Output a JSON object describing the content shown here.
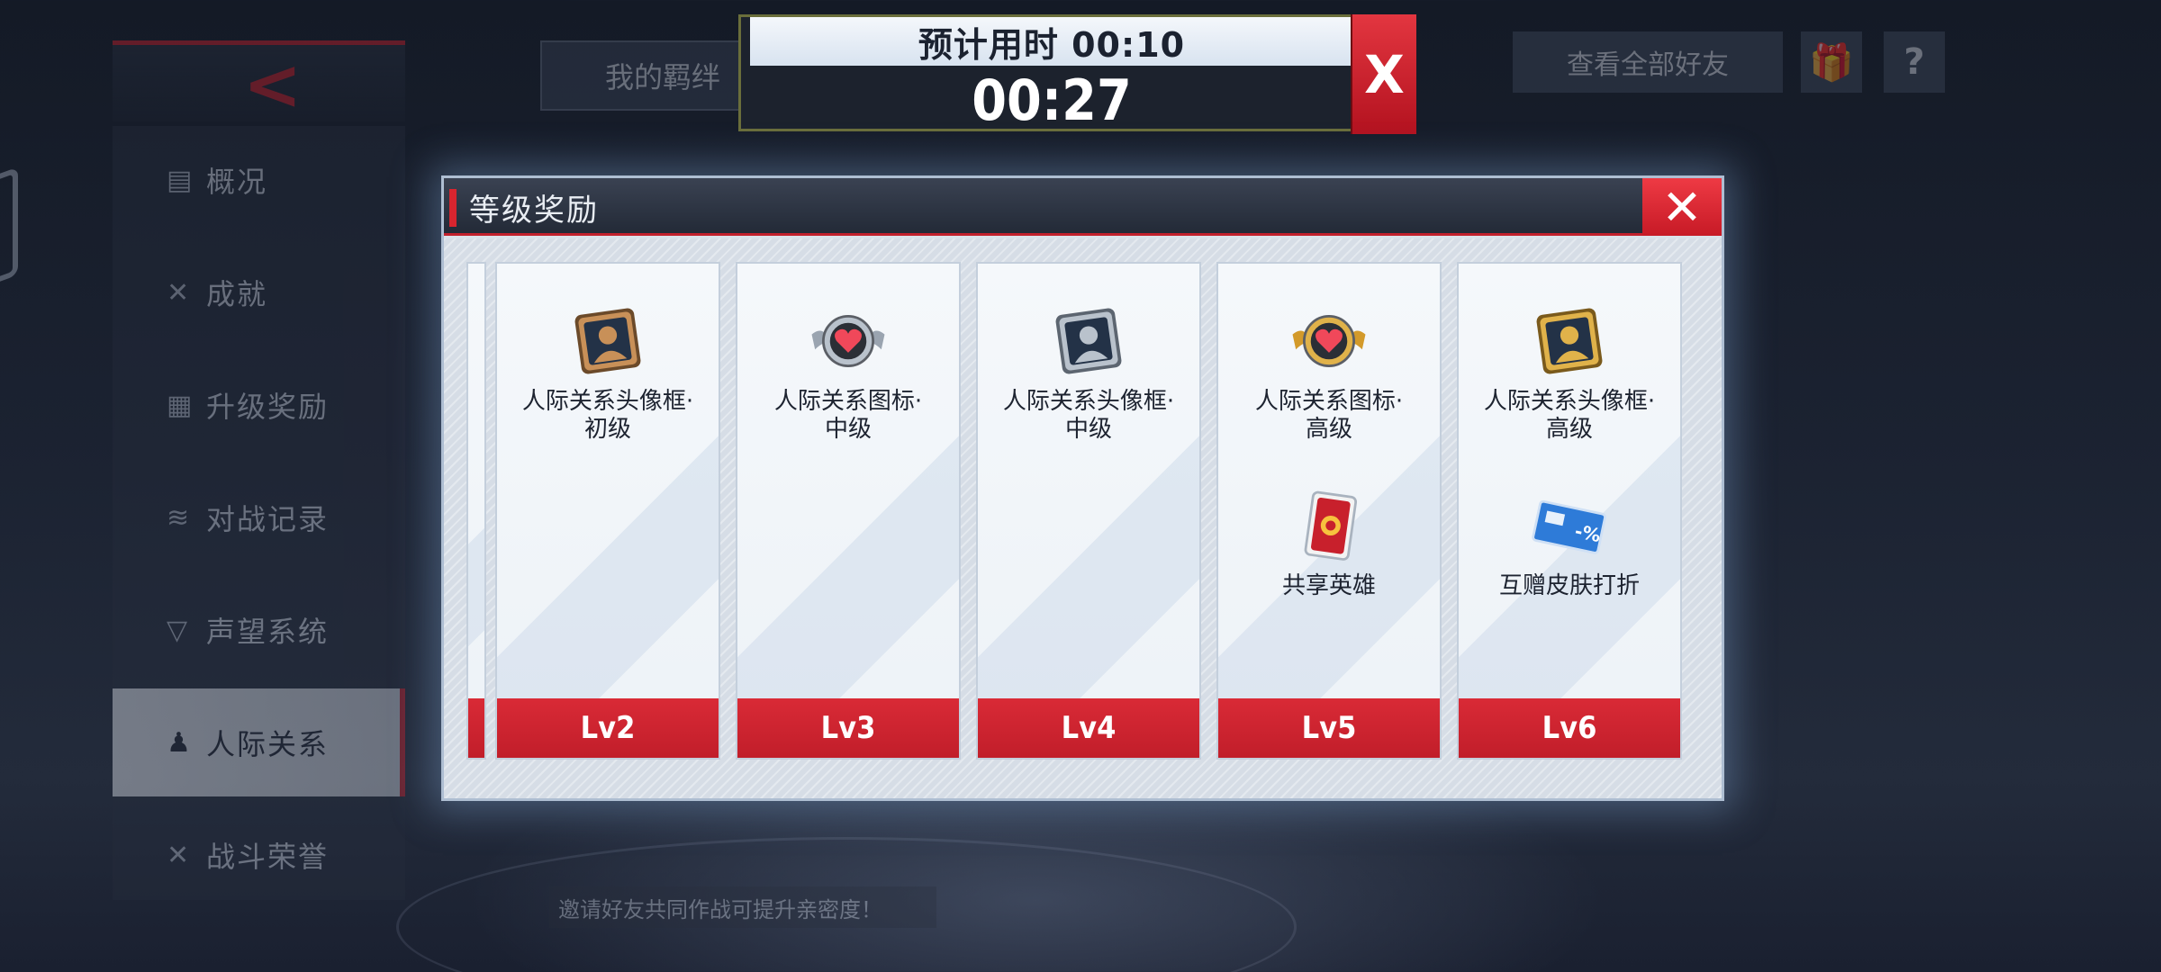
{
  "background": {
    "tab_label": "我的羁绊",
    "right_button_label": "查看全部好友",
    "gift_icon": "gift-icon",
    "help_symbol": "?",
    "sidebar": [
      {
        "icon": "overview-icon",
        "glyph": "▤",
        "label": "概况"
      },
      {
        "icon": "achievement-icon",
        "glyph": "✕",
        "label": "成就"
      },
      {
        "icon": "upgrade-reward-icon",
        "glyph": "▦",
        "label": "升级奖励"
      },
      {
        "icon": "battle-record-icon",
        "glyph": "≋",
        "label": "对战记录"
      },
      {
        "icon": "reputation-icon",
        "glyph": "▽",
        "label": "声望系统"
      },
      {
        "icon": "relationship-icon",
        "glyph": "♟",
        "label": "人际关系"
      },
      {
        "icon": "battle-honor-icon",
        "glyph": "✕",
        "label": "战斗荣誉"
      }
    ],
    "active_sidebar_index": 5,
    "hint": "邀请好友共同作战可提升亲密度！"
  },
  "timer": {
    "estimate_label": "预计用时 00:10",
    "elapsed": "00:27",
    "close_glyph": "X"
  },
  "modal": {
    "title": "等级奖励",
    "close_glyph": "✕",
    "cards": [
      {
        "level": "Lv2",
        "rewards": [
          {
            "icon": "avatar-frame-bronze-icon",
            "label": "人际关系头像框·\n初级"
          }
        ]
      },
      {
        "level": "Lv3",
        "rewards": [
          {
            "icon": "heart-badge-silver-icon",
            "label": "人际关系图标·\n中级"
          }
        ]
      },
      {
        "level": "Lv4",
        "rewards": [
          {
            "icon": "avatar-frame-silver-icon",
            "label": "人际关系头像框·\n中级"
          }
        ]
      },
      {
        "level": "Lv5",
        "rewards": [
          {
            "icon": "heart-badge-gold-icon",
            "label": "人际关系图标·\n高级"
          },
          {
            "icon": "shared-hero-card-icon",
            "label": "共享英雄"
          }
        ]
      },
      {
        "level": "Lv6",
        "rewards": [
          {
            "icon": "avatar-frame-gold-icon",
            "label": "人际关系头像框·\n高级"
          },
          {
            "icon": "skin-discount-ticket-icon",
            "label": "互赠皮肤打折"
          }
        ]
      }
    ]
  },
  "colors": {
    "accent_red": "#c8202c",
    "bronze": "#c89058",
    "silver": "#b9c2cc",
    "gold": "#e0b24a"
  }
}
